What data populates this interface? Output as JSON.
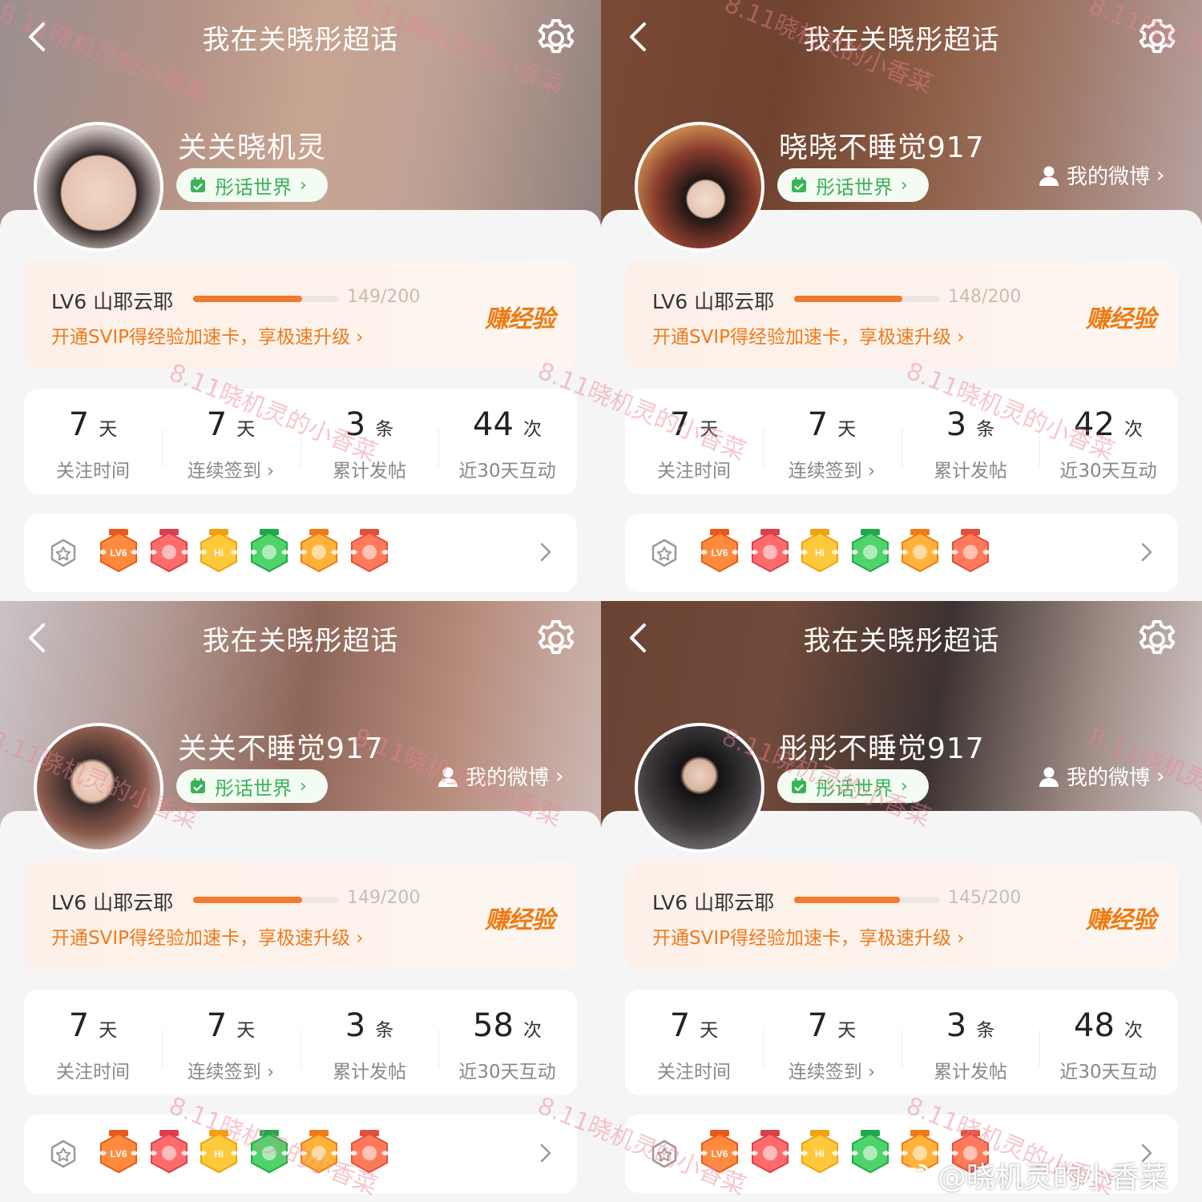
{
  "colors": {
    "accent_orange": "#f27a2e",
    "promo_orange": "#ee7a1c",
    "pill_green": "#3ab25a",
    "watermark_pink": "#ec8092"
  },
  "icons": {
    "back": "chevron-left-icon",
    "settings": "gear-icon",
    "calendar": "calendar-check-icon",
    "person": "person-icon",
    "medal": "medal-icon",
    "row_chevron": "chevron-right-icon"
  },
  "panels": [
    {
      "topbar_title": "我在关晓彤超话",
      "username": "关关晓机灵",
      "world_pill": "彤话世界",
      "weibo_link": "",
      "level": {
        "label": "LV6 山耶云耶",
        "progress": 0.745,
        "count": "149/200",
        "promo": "开通SVIP得经验加速卡，享极速升级 ›",
        "earn": "赚经验"
      },
      "stats": [
        {
          "value": "7",
          "unit": "天",
          "label": "关注时间"
        },
        {
          "value": "7",
          "unit": "天",
          "label": "连续签到 ›"
        },
        {
          "value": "3",
          "unit": "条",
          "label": "累计发帖"
        },
        {
          "value": "44",
          "unit": "次",
          "label": "近30天互动"
        }
      ],
      "badges": [
        "LV6",
        "",
        "Hi",
        "",
        "",
        ""
      ]
    },
    {
      "topbar_title": "我在关晓彤超话",
      "username": "晓晓不睡觉917",
      "world_pill": "彤话世界",
      "weibo_link": "我的微博",
      "level": {
        "label": "LV6 山耶云耶",
        "progress": 0.74,
        "count": "148/200",
        "promo": "开通SVIP得经验加速卡，享极速升级 ›",
        "earn": "赚经验"
      },
      "stats": [
        {
          "value": "7",
          "unit": "天",
          "label": "关注时间"
        },
        {
          "value": "7",
          "unit": "天",
          "label": "连续签到 ›"
        },
        {
          "value": "3",
          "unit": "条",
          "label": "累计发帖"
        },
        {
          "value": "42",
          "unit": "次",
          "label": "近30天互动"
        }
      ],
      "badges": [
        "LV6",
        "",
        "Hi",
        "",
        "",
        ""
      ]
    },
    {
      "topbar_title": "我在关晓彤超话",
      "username": "关关不睡觉917",
      "world_pill": "彤话世界",
      "weibo_link": "我的微博",
      "level": {
        "label": "LV6 山耶云耶",
        "progress": 0.745,
        "count": "149/200",
        "promo": "开通SVIP得经验加速卡，享极速升级 ›",
        "earn": "赚经验"
      },
      "stats": [
        {
          "value": "7",
          "unit": "天",
          "label": "关注时间"
        },
        {
          "value": "7",
          "unit": "天",
          "label": "连续签到 ›"
        },
        {
          "value": "3",
          "unit": "条",
          "label": "累计发帖"
        },
        {
          "value": "58",
          "unit": "次",
          "label": "近30天互动"
        }
      ],
      "badges": [
        "LV6",
        "",
        "Hi",
        "",
        "",
        ""
      ]
    },
    {
      "topbar_title": "我在关晓彤超话",
      "username": "彤彤不睡觉917",
      "world_pill": "彤话世界",
      "weibo_link": "我的微博",
      "level": {
        "label": "LV6 山耶云耶",
        "progress": 0.725,
        "count": "145/200",
        "promo": "开通SVIP得经验加速卡，享极速升级 ›",
        "earn": "赚经验"
      },
      "stats": [
        {
          "value": "7",
          "unit": "天",
          "label": "关注时间"
        },
        {
          "value": "7",
          "unit": "天",
          "label": "连续签到 ›"
        },
        {
          "value": "3",
          "unit": "条",
          "label": "累计发帖"
        },
        {
          "value": "48",
          "unit": "次",
          "label": "近30天互动"
        }
      ],
      "badges": [
        "LV6",
        "",
        "Hi",
        "",
        "",
        ""
      ]
    }
  ],
  "watermark_text": "8.11晓机灵的小香菜",
  "credit": "@晓机灵的小香菜"
}
